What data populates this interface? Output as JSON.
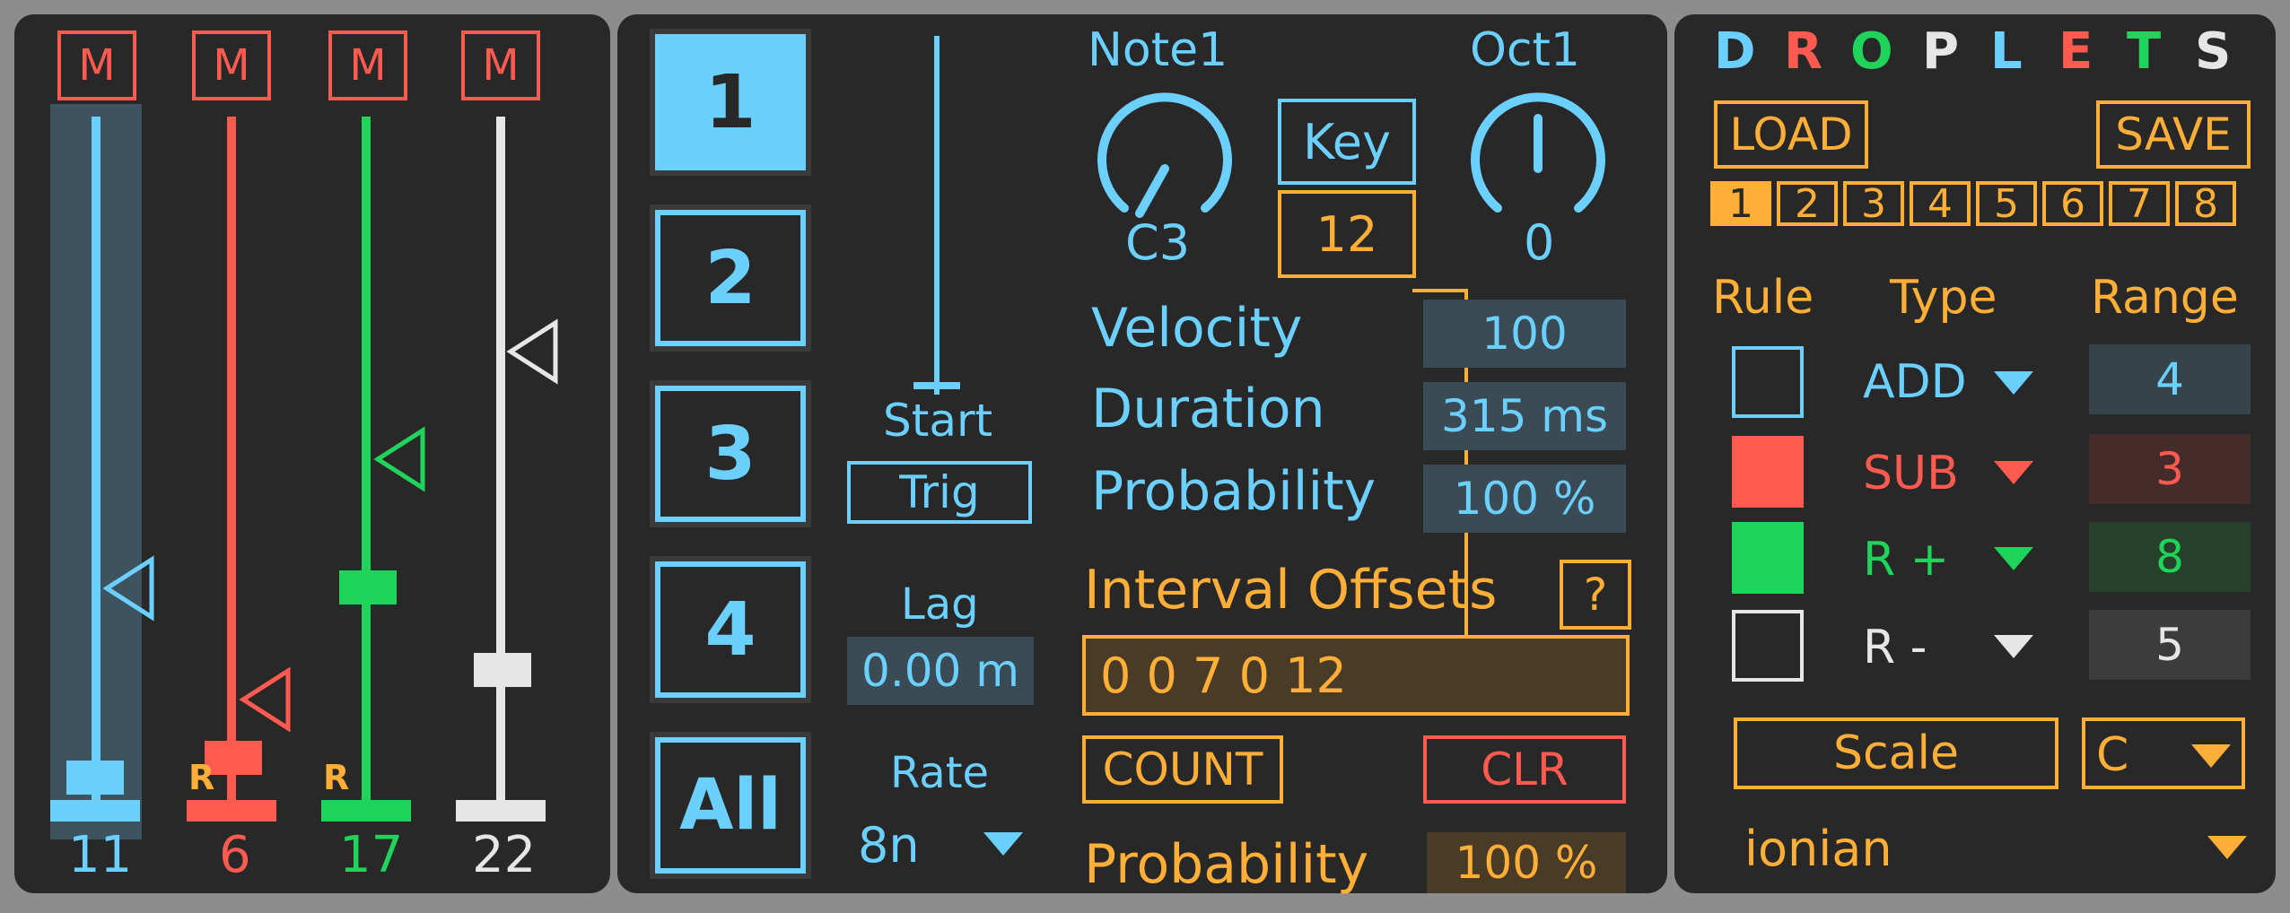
{
  "mixer": {
    "mute_label": "M",
    "reset_label": "R",
    "channels": [
      {
        "value": "11",
        "color": "#6cd0ff"
      },
      {
        "value": "6",
        "color": "#ff5a50"
      },
      {
        "value": "17",
        "color": "#20d35a"
      },
      {
        "value": "22",
        "color": "#e6e6e6"
      }
    ]
  },
  "steps": {
    "buttons": [
      "1",
      "2",
      "3",
      "4",
      "All"
    ],
    "selected": "1"
  },
  "trigger": {
    "start_label": "Start",
    "trig_label": "Trig",
    "lag_label": "Lag",
    "lag_value": "0.00 m",
    "rate_label": "Rate",
    "rate_value": "8n"
  },
  "note": {
    "note_label": "Note1",
    "note_value": "C3",
    "key_label": "Key",
    "key_value": "12",
    "oct_label": "Oct1",
    "oct_value": "0"
  },
  "params": {
    "velocity_label": "Velocity",
    "velocity_value": "100",
    "duration_label": "Duration",
    "duration_value": "315 ms",
    "probability_label": "Probability",
    "probability_value": "100 %"
  },
  "intervals": {
    "label": "Interval Offsets",
    "help_label": "?",
    "value": "0 0 7 0 12",
    "count_label": "COUNT",
    "clr_label": "CLR",
    "probability_label": "Probability",
    "probability_value": "100 %"
  },
  "droplets": {
    "title_letters": [
      {
        "ch": "D",
        "color": "#6cd0ff"
      },
      {
        "ch": "R",
        "color": "#ff5a50"
      },
      {
        "ch": "O",
        "color": "#20d35a"
      },
      {
        "ch": "P",
        "color": "#e6e6e6"
      },
      {
        "ch": "L",
        "color": "#6cd0ff"
      },
      {
        "ch": "E",
        "color": "#ff5a50"
      },
      {
        "ch": "T",
        "color": "#20d35a"
      },
      {
        "ch": "S",
        "color": "#e6e6e6"
      }
    ],
    "load_label": "LOAD",
    "save_label": "SAVE",
    "slots": [
      "1",
      "2",
      "3",
      "4",
      "5",
      "6",
      "7",
      "8"
    ],
    "selected_slot": "1",
    "headers": {
      "rule": "Rule",
      "type": "Type",
      "range": "Range"
    },
    "rules": [
      {
        "type": "ADD",
        "range": "4",
        "color": "#6cd0ff",
        "on": false
      },
      {
        "type": "SUB",
        "range": "3",
        "color": "#ff5a50",
        "on": true
      },
      {
        "type": "R +",
        "range": "8",
        "color": "#20d35a",
        "on": true
      },
      {
        "type": "R -",
        "range": "5",
        "color": "#e6e6e6",
        "on": false
      }
    ],
    "scale_label": "Scale",
    "scale_root": "C",
    "scale_mode": "ionian"
  },
  "colors": {
    "blue": "#6cd0ff",
    "red": "#ff5a50",
    "green": "#20d35a",
    "white": "#e6e6e6",
    "orange": "#ffaf37",
    "panel": "#282828",
    "frame": "#8d8d8d"
  }
}
